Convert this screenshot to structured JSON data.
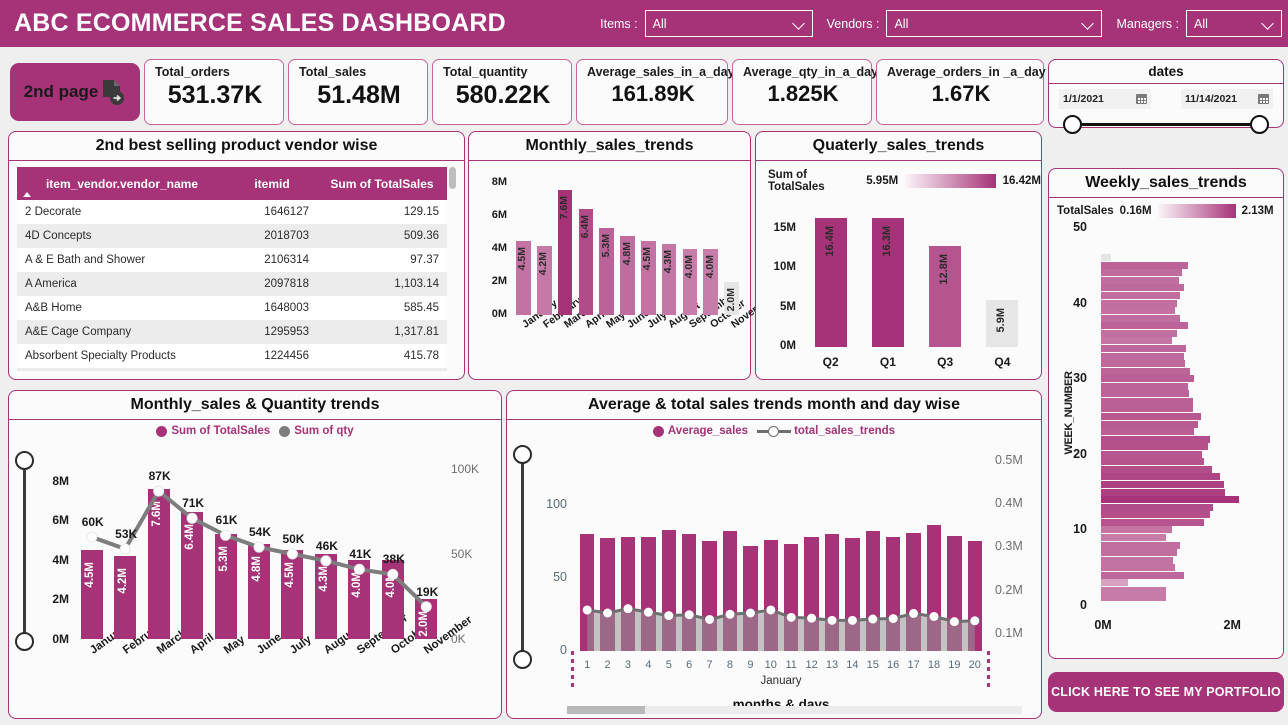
{
  "header": {
    "title": "ABC ECOMMERCE SALES DASHBOARD",
    "accent": "#a63278",
    "slicers": [
      {
        "label": "Items :",
        "value": "All"
      },
      {
        "label": "Vendors :",
        "value": "All"
      },
      {
        "label": "Managers :",
        "value": "All"
      }
    ]
  },
  "page_button": {
    "label": "2nd page"
  },
  "kpis": [
    {
      "title": "Total_orders",
      "value": "531.37K"
    },
    {
      "title": "Total_sales",
      "value": "51.48M"
    },
    {
      "title": "Total_quantity",
      "value": "580.22K"
    },
    {
      "title": "Average_sales_in_a_day",
      "value": "161.89K"
    },
    {
      "title": "Average_qty_in_a_day",
      "value": "1.825K"
    },
    {
      "title": "Average_orders_in _a_day",
      "value": "1.67K"
    }
  ],
  "dates": {
    "title": "dates",
    "start": "1/1/2021",
    "end": "11/14/2021"
  },
  "table_panel": {
    "title": "2nd best selling product vendor wise",
    "columns": [
      "item_vendor.vendor_name",
      "itemid",
      "Sum of TotalSales"
    ],
    "rows": [
      [
        "2 Decorate",
        "1646127",
        "129.15"
      ],
      [
        "4D Concepts",
        "2018703",
        "509.36"
      ],
      [
        "A & E Bath and Shower",
        "2106314",
        "97.37"
      ],
      [
        "A America",
        "2097818",
        "1,103.14"
      ],
      [
        "A&B Home",
        "1648003",
        "585.45"
      ],
      [
        "A&E Cage Company",
        "1295953",
        "1,317.81"
      ],
      [
        "Absorbent Specialty Products",
        "1224456",
        "415.78"
      ]
    ]
  },
  "portfolio_button": {
    "label": "CLICK HERE TO SEE MY PORTFOLIO"
  },
  "chart_data": [
    {
      "id": "monthly_sales_trends",
      "type": "bar",
      "title": "Monthly_sales_trends",
      "categories": [
        "January",
        "February",
        "March",
        "April",
        "May",
        "June",
        "July",
        "August",
        "September",
        "October",
        "November"
      ],
      "values": [
        4.5,
        4.2,
        7.6,
        6.4,
        5.3,
        4.8,
        4.5,
        4.3,
        4.0,
        4.0,
        2.0
      ],
      "labels": [
        "4.5M",
        "4.2M",
        "7.6M",
        "6.4M",
        "5.3M",
        "4.8M",
        "4.5M",
        "4.3M",
        "4.0M",
        "4.0M",
        "2.0M"
      ],
      "ytick_labels": [
        "0M",
        "2M",
        "4M",
        "6M",
        "8M"
      ],
      "ylim": [
        0,
        8
      ],
      "xlabel": "",
      "ylabel": ""
    },
    {
      "id": "quarterly_sales_trends",
      "type": "bar",
      "title": "Quaterly_sales_trends",
      "legend_title": "Sum of TotalSales",
      "legend_min": "5.95M",
      "legend_max": "16.42M",
      "categories": [
        "Q2",
        "Q1",
        "Q3",
        "Q4"
      ],
      "values": [
        16.4,
        16.3,
        12.8,
        5.9
      ],
      "labels": [
        "16.4M",
        "16.3M",
        "12.8M",
        "5.9M"
      ],
      "ytick_labels": [
        "0M",
        "5M",
        "10M",
        "15M"
      ],
      "ylim": [
        0,
        17.5
      ]
    },
    {
      "id": "weekly_sales_trends",
      "type": "bar",
      "title": "Weekly_sales_trends",
      "legend_title": "TotalSales",
      "legend_min": "0.16M",
      "legend_max": "2.13M",
      "ylabel": "WEEK_NUMBER",
      "ytick_labels": [
        "0",
        "10",
        "20",
        "30",
        "40",
        "50"
      ],
      "xtick_labels": [
        "0M",
        "2M"
      ],
      "xlim": [
        0,
        2.6
      ],
      "weeks": [
        46,
        45,
        44,
        43,
        42,
        41,
        40,
        39,
        38,
        37,
        36,
        35,
        34,
        33,
        32,
        31,
        30,
        29,
        28,
        27,
        26,
        25,
        24,
        23,
        22,
        21,
        20,
        19,
        18,
        17,
        16,
        15,
        14,
        13,
        12,
        11,
        10,
        9,
        8,
        7,
        6,
        5,
        4,
        3,
        2,
        1
      ],
      "values": [
        0.16,
        1.35,
        1.25,
        1.2,
        1.28,
        1.22,
        1.18,
        1.15,
        1.22,
        1.35,
        1.18,
        1.1,
        1.32,
        1.28,
        1.3,
        1.38,
        1.44,
        1.35,
        1.36,
        1.42,
        1.42,
        1.54,
        1.5,
        1.44,
        1.68,
        1.66,
        1.56,
        1.6,
        1.72,
        1.84,
        1.9,
        1.92,
        2.13,
        1.74,
        1.68,
        1.6,
        1.1,
        1.0,
        1.22,
        1.18,
        1.12,
        1.14,
        1.28,
        0.42,
        1.0,
        1.0
      ]
    },
    {
      "id": "monthly_sales_and_quantity_trends",
      "type": "bar",
      "title": "Monthly_sales & Quantity trends",
      "legend": [
        "Sum of TotalSales",
        "Sum of qty"
      ],
      "categories": [
        "January",
        "February",
        "March",
        "April",
        "May",
        "June",
        "July",
        "August",
        "September",
        "October",
        "November"
      ],
      "series": [
        {
          "name": "Sum of TotalSales",
          "values": [
            4.5,
            4.2,
            7.6,
            6.4,
            5.3,
            4.8,
            4.5,
            4.3,
            4.0,
            4.0,
            2.0
          ],
          "labels": [
            "4.5M",
            "4.2M",
            "7.6M",
            "6.4M",
            "5.3M",
            "4.8M",
            "4.5M",
            "4.3M",
            "4.0M",
            "4.0M",
            "2.0M"
          ]
        },
        {
          "name": "Sum of qty",
          "values": [
            60,
            53,
            87,
            71,
            61,
            54,
            50,
            46,
            41,
            38,
            19
          ],
          "labels": [
            "60K",
            "53K",
            "87K",
            "71K",
            "61K",
            "54K",
            "50K",
            "46K",
            "41K",
            "38K",
            "19K"
          ]
        }
      ],
      "ytick_labels_left": [
        "0M",
        "2M",
        "4M",
        "6M",
        "8M"
      ],
      "ytick_labels_right": [
        "0K",
        "50K",
        "100K"
      ],
      "ylim_left": [
        0,
        8.6
      ],
      "ylim_right": [
        0,
        100
      ]
    },
    {
      "id": "average_and_total_sales_trends",
      "type": "bar",
      "title": "Average & total sales trends month and day wise",
      "legend": [
        "Average_sales",
        "total_sales_trends"
      ],
      "xlabel": "months & days",
      "x_group": "January",
      "categories": [
        "1",
        "2",
        "3",
        "4",
        "5",
        "6",
        "7",
        "8",
        "9",
        "10",
        "11",
        "12",
        "13",
        "14",
        "15",
        "16",
        "17",
        "18",
        "19",
        "20"
      ],
      "series": [
        {
          "name": "Average_sales",
          "values": [
            80,
            77,
            78,
            78,
            83,
            80,
            75,
            82,
            72,
            76,
            73,
            78,
            80,
            77,
            82,
            78,
            81,
            86,
            79,
            75
          ]
        },
        {
          "name": "total_sales_trends",
          "values": [
            0.155,
            0.148,
            0.158,
            0.15,
            0.142,
            0.144,
            0.133,
            0.145,
            0.148,
            0.155,
            0.138,
            0.136,
            0.131,
            0.131,
            0.134,
            0.135,
            0.147,
            0.14,
            0.128,
            0.13
          ]
        }
      ],
      "ytick_labels_left": [
        "0",
        "50",
        "100"
      ],
      "ytick_labels_right": [
        "0.1M",
        "0.2M",
        "0.3M",
        "0.4M",
        "0.5M"
      ],
      "ylim_left": [
        0,
        130
      ],
      "ylim_right": [
        0.06,
        0.5
      ]
    }
  ]
}
